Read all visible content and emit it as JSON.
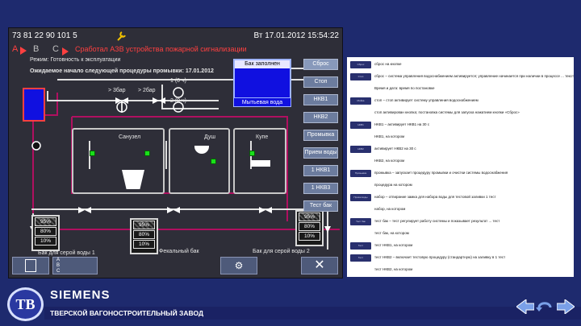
{
  "header": {
    "id_text": "73 81 22 90 101 5",
    "datetime": "Вт 17.01.2012 15:54:22",
    "alarm_letters": [
      "А",
      "В",
      "С"
    ],
    "alarm_message": "Сработал АЗВ устройства пожарной сигнализации",
    "mode_text": "Режим: Готовность к эксплуатации",
    "wait_text": "Ожидаемое начало следующей процедуры промывки: 17.01.2012",
    "bak_label": "Бак заполнен"
  },
  "diagram": {
    "pressure_left": "> 3бар",
    "pressure_right": "> 2бар",
    "flow_top": "1 (0 ч)",
    "flow_mid": "2 (0 ч)",
    "mixer_label": "Мытьевая вода",
    "rooms": [
      "Санузел",
      "Душ",
      "Купе"
    ],
    "tank_left": [
      "95%",
      "80%",
      "10%"
    ],
    "tank_mid": [
      "95%",
      "80%",
      "10%"
    ],
    "tank_right": [
      "95%",
      "80%",
      "10%"
    ],
    "label_left_tank": "Бак для серой воды 1",
    "label_mid_tank": "Фекальный бак",
    "label_right_tank": "Бак для серой воды 2",
    "legend_letters": [
      "A",
      "B",
      "C"
    ]
  },
  "side_buttons": [
    "Сброс",
    "Стоп",
    "НКВ1",
    "НКВ2",
    "Промывка",
    "Прием воды",
    "1 НКВ1",
    "1 НКВ3",
    "Тест бак"
  ],
  "doc_rows": [
    {
      "badge": "Сброс",
      "text": "сброс на кнопке"
    },
    {
      "badge": "Стоп",
      "text": "сброс – система управления водоснабжением активируется; управление начинается при наличии в процессе ... текст документа ..."
    },
    {
      "badge": "",
      "text": "Время и дата: время по постановке"
    },
    {
      "badge": "Мойка",
      "text": "стоп – стоп активирует систему управления водоснабжением"
    },
    {
      "badge": "",
      "text": "стоп активирован кнопка; постановка системы для запуска нажатием кнопки «Сброс»"
    },
    {
      "badge": "НКВ1",
      "text": "НКВ1 – активирует НКВ1 на 30 с"
    },
    {
      "badge": "",
      "text": "НКВ1, на котором"
    },
    {
      "badge": "НКВ2",
      "text": "активирует НКВ2 на 30 с"
    },
    {
      "badge": "",
      "text": "НКВ2, на котором"
    },
    {
      "badge": "Промывка",
      "text": "промывка – запускает процедуру промывки и очистки системы водоснабжения"
    },
    {
      "badge": "",
      "text": "процедура на котором"
    },
    {
      "badge": "Приём воды",
      "text": "набор – отпирание замка для набора воды для тестовой заливки 1 тест"
    },
    {
      "badge": "",
      "text": "набор, на котором"
    },
    {
      "badge": "Тест бак",
      "text": "тест бак – тест регулирует работу системы и показывает результат ... тест"
    },
    {
      "badge": "",
      "text": "тест бак, на котором"
    },
    {
      "badge": "Тест",
      "text": "тест НКВ1, на котором"
    },
    {
      "badge": "Тест",
      "text": "тест НКВ2 – включает тестовую процедуру (стандартную) на заливку в 1 тест"
    },
    {
      "badge": "",
      "text": "тест НКВ2, на котором"
    }
  ],
  "footer": {
    "logo_text": "ТВ",
    "brand": "SIEMENS",
    "company": "ТВЕРСКОЙ ВАГОНОСТРОИТЕЛЬНЫЙ ЗАВОД"
  },
  "colors": {
    "background": "#1e2a6e",
    "hmi_bg": "#2e2e38",
    "button": "#6c7c9e",
    "pipe_red": "#b01060",
    "pipe_white": "#e0e0e0",
    "tank_blue": "#1010e0",
    "led_green": "#19e019"
  }
}
